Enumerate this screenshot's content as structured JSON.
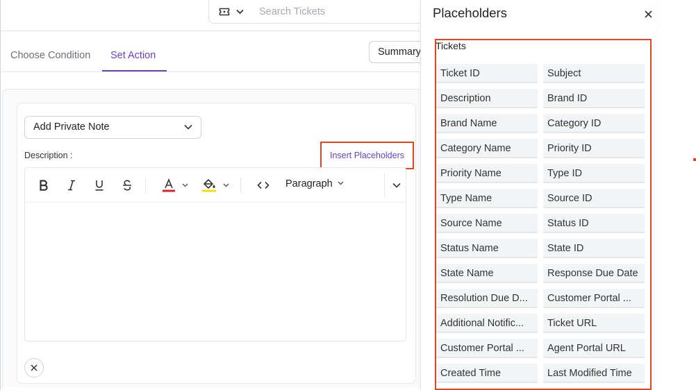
{
  "search": {
    "placeholder": "Search Tickets"
  },
  "tabs": [
    {
      "label": "Choose Condition",
      "active": false
    },
    {
      "label": "Set Action",
      "active": true
    }
  ],
  "summary_button": "Summary",
  "action": {
    "select_value": "Add Private Note",
    "description_label": "Description :",
    "insert_placeholders_label": "Insert Placeholders",
    "toolbar": {
      "bold_icon": "bold-icon",
      "italic_icon": "italic-icon",
      "underline_icon": "underline-icon",
      "strikethrough_icon": "strikethrough-icon",
      "font_color_icon": "font-color-icon",
      "highlight_icon": "highlight-icon",
      "code_icon": "code-icon",
      "paragraph_label": "Paragraph"
    }
  },
  "placeholders_panel": {
    "title": "Placeholders",
    "group_label": "Tickets",
    "items": [
      "Ticket ID",
      "Subject",
      "Description",
      "Brand ID",
      "Brand Name",
      "Category ID",
      "Category Name",
      "Priority ID",
      "Priority Name",
      "Type ID",
      "Type Name",
      "Source ID",
      "Source Name",
      "Status ID",
      "Status Name",
      "State ID",
      "State Name",
      "Response Due Date",
      "Resolution Due D...",
      "Customer Portal ...",
      "Additional Notific...",
      "Ticket URL",
      "Customer Portal ...",
      "Agent Portal URL",
      "Created Time",
      "Last Modified Time"
    ]
  },
  "colors": {
    "accent": "#6a3fd6",
    "highlight_border": "#e8431f",
    "font_color_bar": "#e02020",
    "highlight_color_bar": "#f5e100"
  }
}
